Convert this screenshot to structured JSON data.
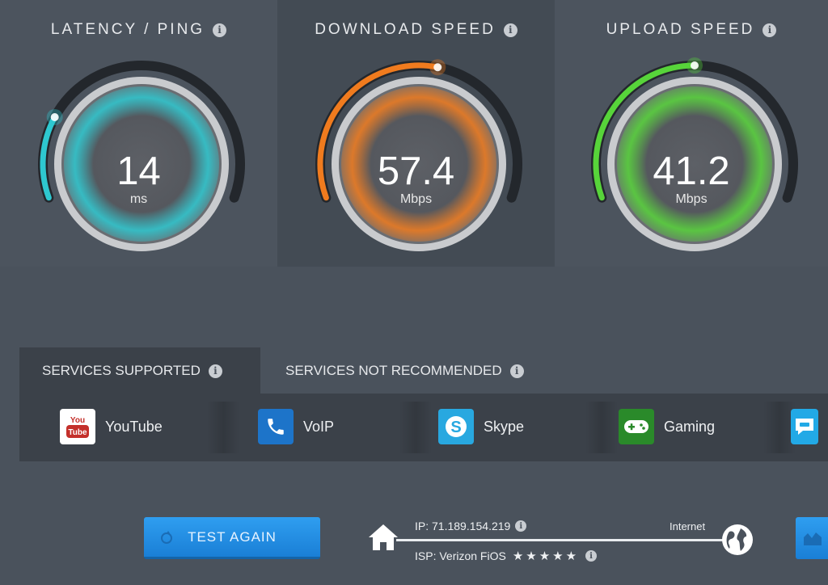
{
  "gauges": [
    {
      "title": "LATENCY / PING",
      "value": "14",
      "unit": "ms",
      "accent": "#2ec8d0",
      "fraction": 0.22
    },
    {
      "title": "DOWNLOAD SPEED",
      "value": "57.4",
      "unit": "Mbps",
      "accent": "#f07b1e",
      "fraction": 0.55
    },
    {
      "title": "UPLOAD SPEED",
      "value": "41.2",
      "unit": "Mbps",
      "accent": "#57d43a",
      "fraction": 0.5
    }
  ],
  "tabs": {
    "supported": "SERVICES SUPPORTED",
    "not_recommended": "SERVICES NOT RECOMMENDED"
  },
  "services": [
    {
      "label": "YouTube",
      "icon": "youtube-icon",
      "color": "#ffffff"
    },
    {
      "label": "VoIP",
      "icon": "phone-icon",
      "color": "#1d74c9"
    },
    {
      "label": "Skype",
      "icon": "skype-icon",
      "color": "#28a8e0"
    },
    {
      "label": "Gaming",
      "icon": "gamepad-icon",
      "color": "#2a8a2a"
    },
    {
      "label": "",
      "icon": "chat-icon",
      "color": "#22a9e6"
    }
  ],
  "footer": {
    "test_again": "TEST AGAIN",
    "ip": "IP: 71.189.154.219",
    "isp": "ISP: Verizon FiOS",
    "rating_stars": "★★★★★",
    "internet": "Internet"
  },
  "info_glyph": "i"
}
